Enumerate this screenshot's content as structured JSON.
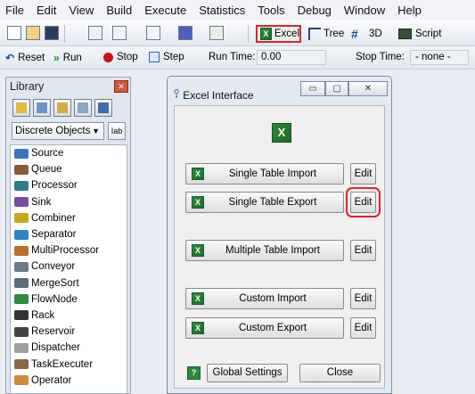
{
  "menu": [
    "File",
    "Edit",
    "View",
    "Build",
    "Execute",
    "Statistics",
    "Tools",
    "Debug",
    "Window",
    "Help"
  ],
  "toolbar": {
    "excel_label": "Excel",
    "tree_label": "Tree",
    "threed_label": "3D",
    "script_label": "Script"
  },
  "runbar": {
    "reset": "Reset",
    "run": "Run",
    "stop": "Stop",
    "step": "Step",
    "run_time_label": "Run Time:",
    "run_time_value": "0.00",
    "stop_time_label": "Stop Time:",
    "stop_time_value": "- none -"
  },
  "library": {
    "title": "Library",
    "close_glyph": "✕",
    "dropdown": "Discrete Objects",
    "dropdown_arrow": "▼",
    "text_tool": "Iab",
    "items": [
      {
        "label": "Source",
        "color": "#3a74c9"
      },
      {
        "label": "Queue",
        "color": "#8b5a3a"
      },
      {
        "label": "Processor",
        "color": "#2e7d8c"
      },
      {
        "label": "Sink",
        "color": "#7a4aa8"
      },
      {
        "label": "Combiner",
        "color": "#c9a61e"
      },
      {
        "label": "Separator",
        "color": "#2a86c7"
      },
      {
        "label": "MultiProcessor",
        "color": "#b8702a"
      },
      {
        "label": "Conveyor",
        "color": "#6a7a8a"
      },
      {
        "label": "MergeSort",
        "color": "#5d6c7c"
      },
      {
        "label": "FlowNode",
        "color": "#2f8a3c"
      },
      {
        "label": "Rack",
        "color": "#333333"
      },
      {
        "label": "Reservoir",
        "color": "#444444"
      },
      {
        "label": "Dispatcher",
        "color": "#a0a0a0"
      },
      {
        "label": "TaskExecuter",
        "color": "#8b6a40"
      },
      {
        "label": "Operator",
        "color": "#d08a3a"
      }
    ]
  },
  "dialog": {
    "title": "Excel Interface",
    "title_icon": "⯱",
    "min_glyph": "▭",
    "max_glyph": "▢",
    "close_glyph": "✕",
    "logo": "X",
    "buttons": [
      {
        "label": "Single Table Import",
        "edit": "Edit",
        "highlighted": false
      },
      {
        "label": "Single Table Export",
        "edit": "Edit",
        "highlighted": true
      },
      {
        "label": "Multiple Table Import",
        "edit": "Edit",
        "highlighted": false
      },
      {
        "label": "Custom Import",
        "edit": "Edit",
        "highlighted": false
      },
      {
        "label": "Custom Export",
        "edit": "Edit",
        "highlighted": false
      }
    ],
    "help_glyph": "?",
    "global_settings": "Global Settings",
    "close": "Close"
  },
  "colors": {
    "highlight": "#e0222b",
    "excel_green": "#1e7b2f"
  }
}
